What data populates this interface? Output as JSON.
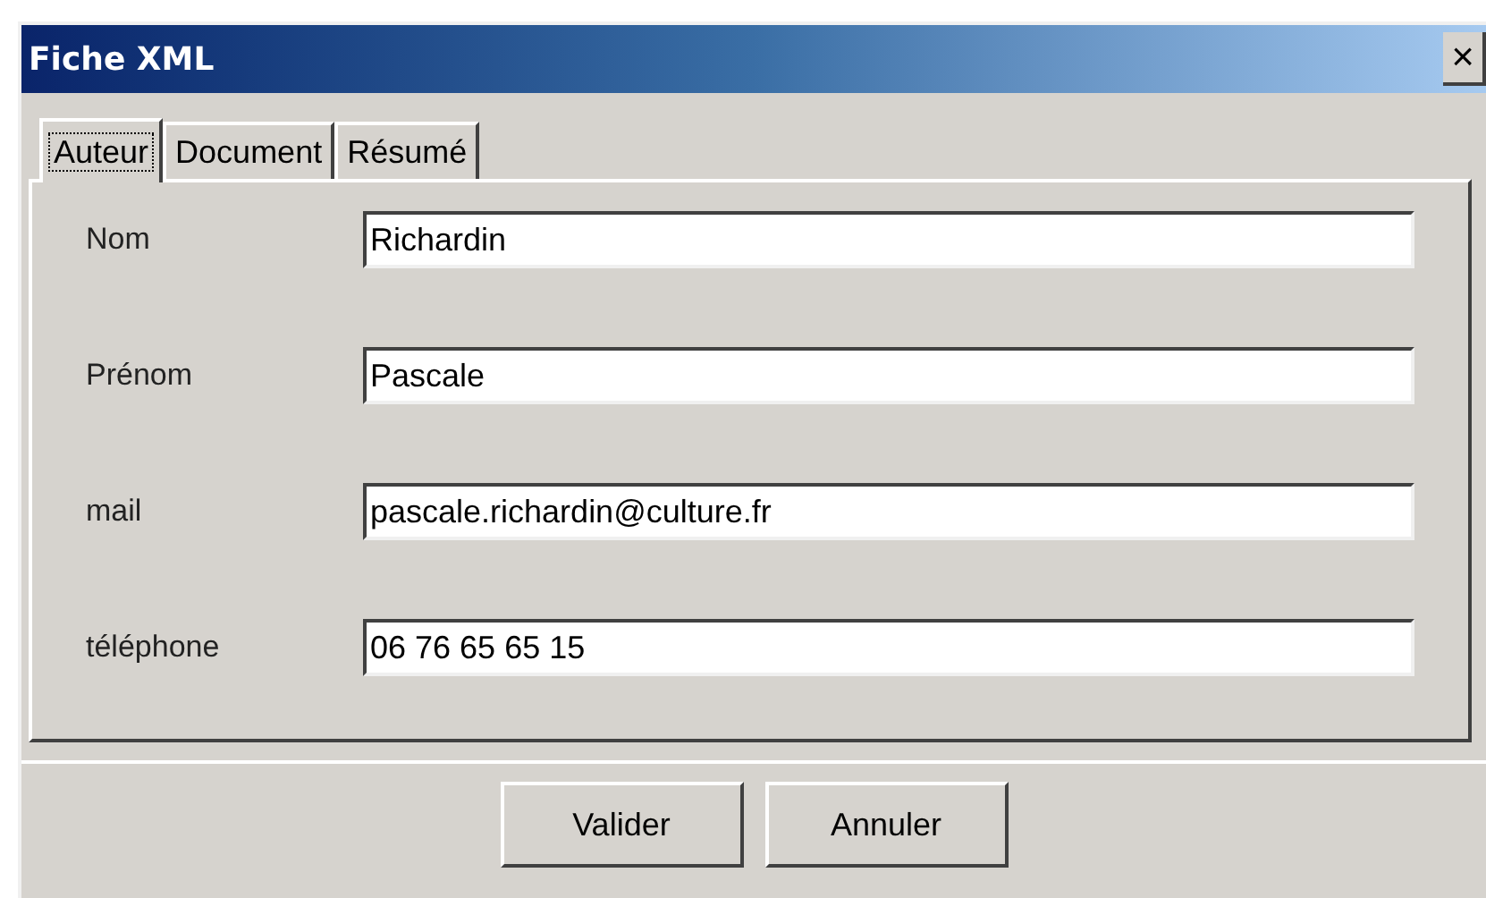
{
  "window": {
    "title": "Fiche XML",
    "close": "×"
  },
  "tabs": [
    {
      "label": "Auteur",
      "selected": true
    },
    {
      "label": "Document",
      "selected": false
    },
    {
      "label": "Résumé",
      "selected": false
    }
  ],
  "fields": [
    {
      "label": "Nom",
      "value": "Richardin"
    },
    {
      "label": "Prénom",
      "value": "Pascale"
    },
    {
      "label": "mail",
      "value": "pascale.richardin@culture.fr"
    },
    {
      "label": "téléphone",
      "value": "06 76 65 65 15"
    }
  ],
  "buttons": [
    "Valider",
    "Annuler"
  ]
}
